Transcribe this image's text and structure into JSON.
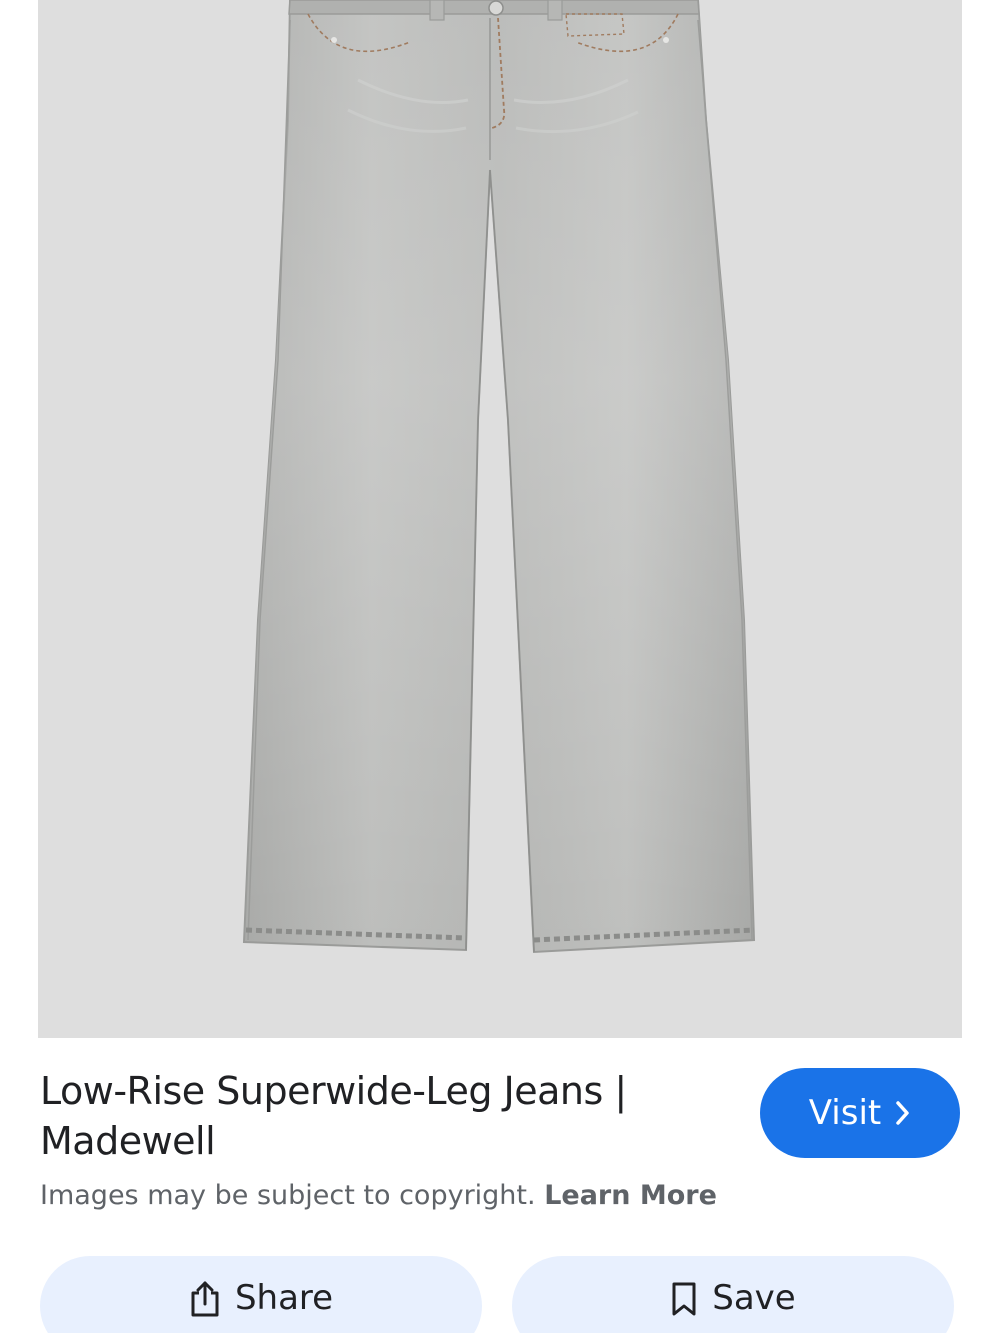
{
  "result": {
    "title": "Low-Rise Superwide-Leg Jeans | Madewell",
    "visit_label": "Visit",
    "copyright_text": "Images may be subject to copyright.",
    "learn_more_label": "Learn More"
  },
  "actions": {
    "share_label": "Share",
    "save_label": "Save"
  },
  "icons": {
    "visit": "chevron-right-icon",
    "share": "share-icon",
    "save": "bookmark-icon"
  },
  "colors": {
    "accent": "#1a73e8",
    "action_bg": "#e8f0fe",
    "image_bg": "#dedede"
  }
}
